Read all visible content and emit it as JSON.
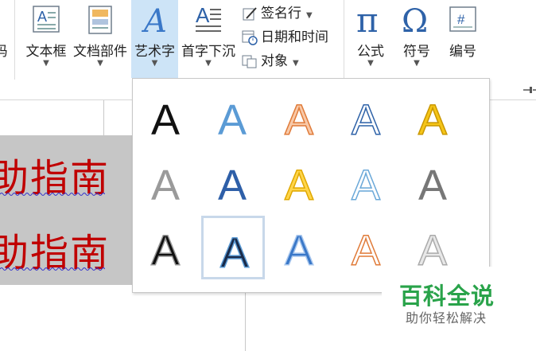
{
  "ribbon": {
    "partial_label": "码",
    "buttons": [
      {
        "id": "textbox",
        "label": "文本框"
      },
      {
        "id": "quickparts",
        "label": "文档部件"
      },
      {
        "id": "wordart",
        "label": "艺术字"
      },
      {
        "id": "dropcap",
        "label": "首字下沉"
      },
      {
        "id": "equation",
        "label": "公式"
      },
      {
        "id": "symbol",
        "label": "符号"
      },
      {
        "id": "number",
        "label": "编号"
      }
    ],
    "small_buttons": [
      {
        "id": "signature",
        "label": "签名行"
      },
      {
        "id": "datetime",
        "label": "日期和时间"
      },
      {
        "id": "object",
        "label": "对象"
      }
    ],
    "icon_glyphs": {
      "equation": "π",
      "symbol": "Ω",
      "number": "#",
      "wordart": "A",
      "dropcap": "A"
    }
  },
  "document": {
    "lines": [
      "助指南",
      "助指南"
    ]
  },
  "wordart_gallery": {
    "glyph": "A",
    "selected_index": 11,
    "styles": [
      {
        "fill": "#111111",
        "stroke": "none"
      },
      {
        "fill": "#5b9bd5",
        "stroke": "none"
      },
      {
        "fill": "#f8c9a8",
        "stroke": "#e07b39"
      },
      {
        "fill": "#ffffff",
        "stroke": "#2e62a8"
      },
      {
        "fill": "#f5c518",
        "stroke": "#c99700"
      },
      {
        "fill": "#9a9a9a",
        "stroke": "none"
      },
      {
        "fill": "#2e5fa8",
        "stroke": "none"
      },
      {
        "fill": "#ffd54a",
        "stroke": "#e0a800"
      },
      {
        "fill": "#ffffff",
        "stroke": "#6aa8d8"
      },
      {
        "fill": "#777777",
        "stroke": "none"
      },
      {
        "fill": "#111111",
        "stroke": "#999999"
      },
      {
        "fill": "#1a2b4a",
        "stroke": "#5b9bd5"
      },
      {
        "fill": "#3a78c8",
        "stroke": "#aac8ee"
      },
      {
        "fill": "#ffffff",
        "stroke": "#e07b39"
      },
      {
        "fill": "#e8e8e8",
        "stroke": "#aaaaaa"
      }
    ]
  },
  "watermark": {
    "title": "百科全说",
    "subtitle": "助你轻松解决"
  }
}
